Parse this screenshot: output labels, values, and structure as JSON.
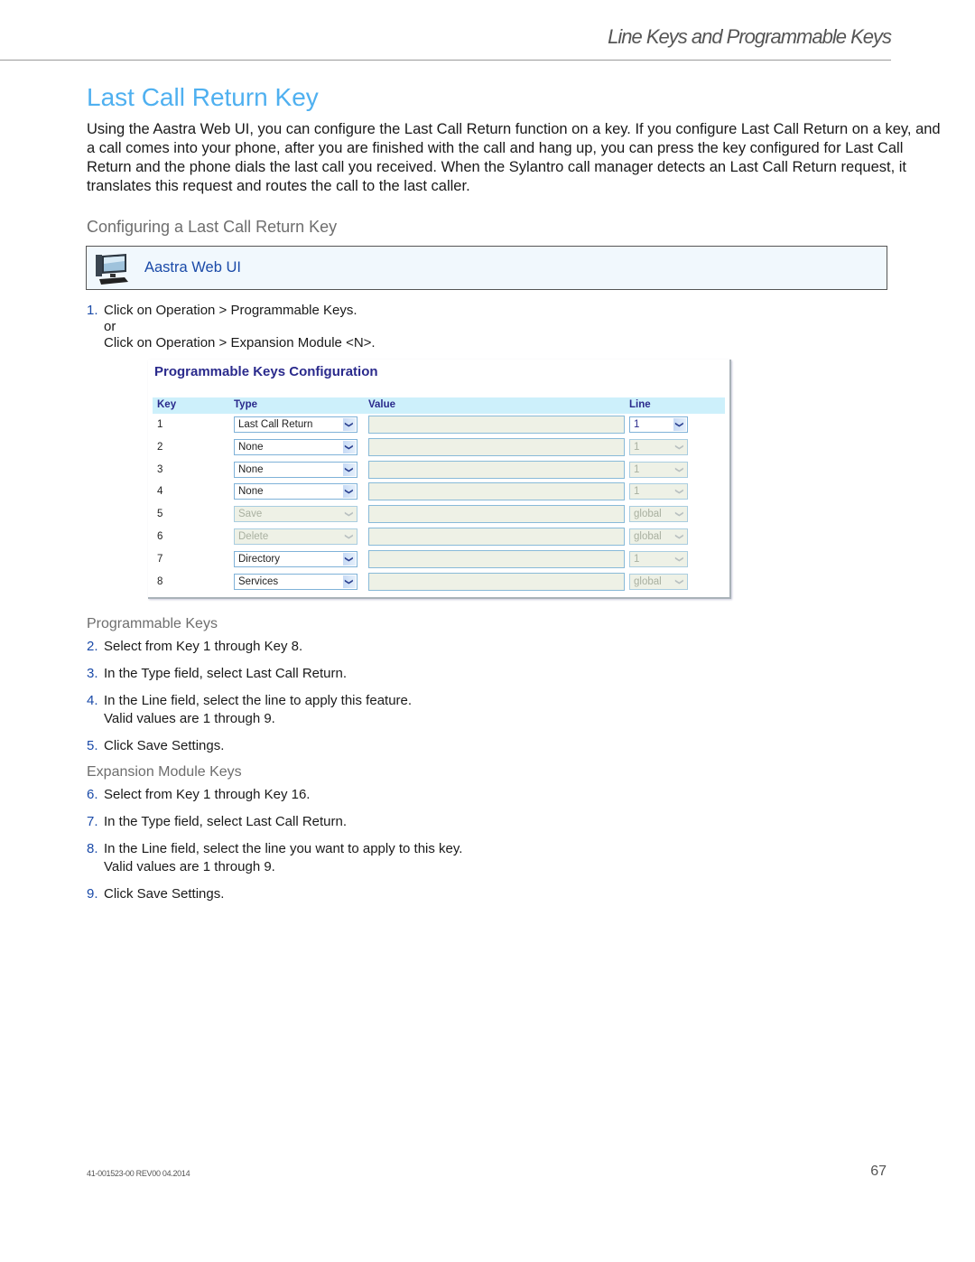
{
  "header": {
    "running_head": "Line Keys and Programmable Keys"
  },
  "page_title": "Last Call Return Key",
  "intro": "Using the Aastra Web UI, you can configure the Last Call Return function on a key. If you configure Last Call Return on a key, and a call comes into your phone, after you are finished with the call and hang up, you can press the key configured for Last Call Return and the phone dials the last call you received. When the Sylantro call manager detects an Last Call Return request, it translates this request and routes the call to the last caller.",
  "section_title": "Configuring a Last Call Return Key",
  "webui_box": {
    "icon": "computer-monitor-icon",
    "label": "Aastra Web UI"
  },
  "step1": {
    "num": "1.",
    "line1": "Click on Operation > Programmable Keys.",
    "or": "or",
    "line2": "Click on Operation > Expansion Module <N>."
  },
  "screenshot": {
    "title": "Programmable Keys Configuration",
    "columns": [
      "Key",
      "Type",
      "Value",
      "Line"
    ],
    "rows": [
      {
        "key": "1",
        "type": "Last Call Return",
        "type_enabled": true,
        "value": "",
        "line": "1",
        "line_enabled": true
      },
      {
        "key": "2",
        "type": "None",
        "type_enabled": true,
        "value": "",
        "line": "1",
        "line_enabled": false
      },
      {
        "key": "3",
        "type": "None",
        "type_enabled": true,
        "value": "",
        "line": "1",
        "line_enabled": false
      },
      {
        "key": "4",
        "type": "None",
        "type_enabled": true,
        "value": "",
        "line": "1",
        "line_enabled": false
      },
      {
        "key": "5",
        "type": "Save",
        "type_enabled": false,
        "value": "",
        "line": "global",
        "line_enabled": false
      },
      {
        "key": "6",
        "type": "Delete",
        "type_enabled": false,
        "value": "",
        "line": "global",
        "line_enabled": false
      },
      {
        "key": "7",
        "type": "Directory",
        "type_enabled": true,
        "value": "",
        "line": "1",
        "line_enabled": false
      },
      {
        "key": "8",
        "type": "Services",
        "type_enabled": true,
        "value": "",
        "line": "global",
        "line_enabled": false
      }
    ],
    "dropdown_icon": "chevron-down-icon"
  },
  "programmable_keys": {
    "title": "Programmable Keys",
    "steps": [
      {
        "num": "2.",
        "text": "Select from Key 1 through Key 8."
      },
      {
        "num": "3.",
        "text": "In the Type field, select Last Call Return."
      },
      {
        "num": "4.",
        "text": "In the Line field, select the line to apply this feature.",
        "cont": "Valid values are 1 through 9."
      },
      {
        "num": "5.",
        "text": "Click Save Settings."
      }
    ]
  },
  "expansion_module_keys": {
    "title": "Expansion Module Keys",
    "steps": [
      {
        "num": "6.",
        "text": "Select from Key 1 through Key 16."
      },
      {
        "num": "7.",
        "text": "In the Type field, select Last Call Return."
      },
      {
        "num": "8.",
        "text": "In the Line field, select the line you want to apply to this key.",
        "cont": "Valid values are 1 through 9."
      },
      {
        "num": "9.",
        "text": "Click Save Settings."
      }
    ]
  },
  "footer": {
    "doc_id": "41-001523-00 REV00   04.2014",
    "page_number": "67"
  }
}
